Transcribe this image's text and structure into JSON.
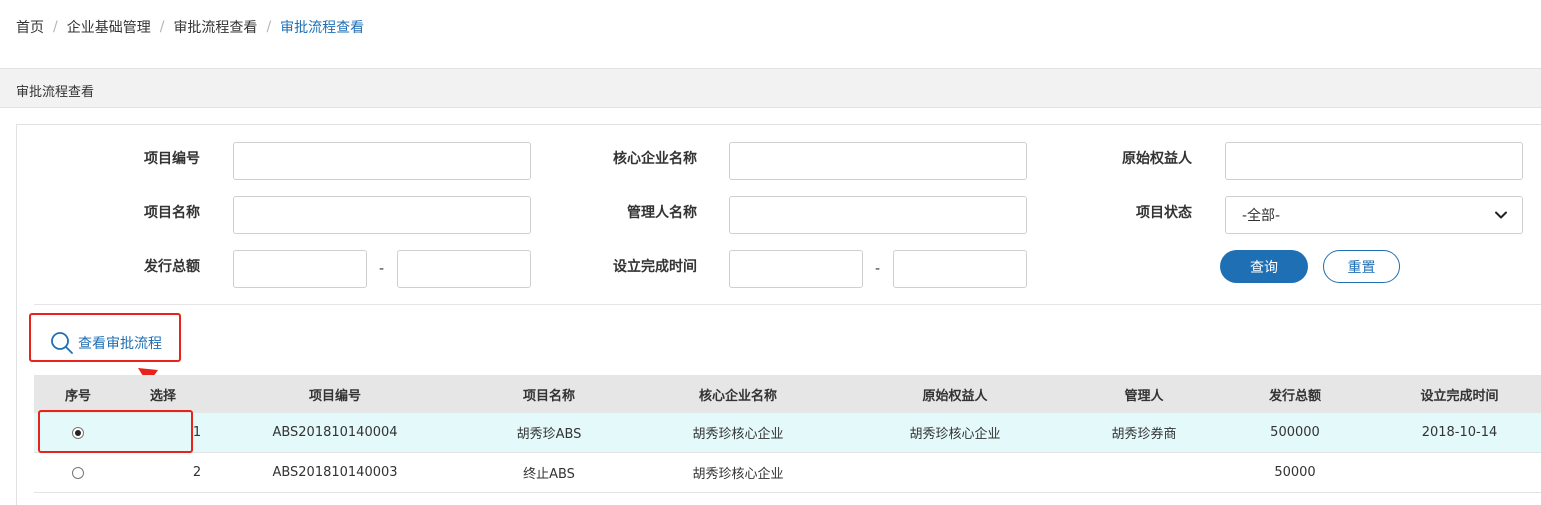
{
  "breadcrumb": {
    "items": [
      "首页",
      "企业基础管理",
      "审批流程查看"
    ],
    "current": "审批流程查看",
    "separator": "/"
  },
  "panel": {
    "title": "审批流程查看"
  },
  "filters": {
    "project_code": {
      "label": "项目编号",
      "value": ""
    },
    "core_company": {
      "label": "核心企业名称",
      "value": ""
    },
    "original_owner": {
      "label": "原始权益人",
      "value": ""
    },
    "project_name": {
      "label": "项目名称",
      "value": ""
    },
    "manager_name": {
      "label": "管理人名称",
      "value": ""
    },
    "project_status": {
      "label": "项目状态",
      "selected": "-全部-"
    },
    "issue_amount": {
      "label": "发行总额",
      "from": "",
      "to": "",
      "range_sep": "-"
    },
    "setup_time": {
      "label": "设立完成时间",
      "from": "",
      "to": "",
      "range_sep": "-"
    },
    "query_label": "查询",
    "reset_label": "重置"
  },
  "actions": {
    "view_flow_label": "查看审批流程"
  },
  "table": {
    "columns": [
      "序号",
      "选择",
      "项目编号",
      "项目名称",
      "核心企业名称",
      "原始权益人",
      "管理人",
      "发行总额",
      "设立完成时间"
    ],
    "rows": [
      {
        "selected": true,
        "index": "1",
        "project_code": "ABS201810140004",
        "project_name": "胡秀珍ABS",
        "core_company": "胡秀珍核心企业",
        "original_owner": "胡秀珍核心企业",
        "manager": "胡秀珍券商",
        "issue_amount": "500000",
        "setup_time": "2018-10-14"
      },
      {
        "selected": false,
        "index": "2",
        "project_code": "ABS201810140003",
        "project_name": "终止ABS",
        "core_company": "胡秀珍核心企业",
        "original_owner": "",
        "manager": "",
        "issue_amount": "50000",
        "setup_time": ""
      }
    ]
  },
  "colors": {
    "accent": "#1f6fb5",
    "highlight": "#e8231b",
    "selected_row": "#e4f9fa",
    "header_bg": "#e6e6e6"
  },
  "icons": {
    "search": "search-icon",
    "chevron": "chevron-down-icon",
    "arrow": "arrow-icon"
  }
}
